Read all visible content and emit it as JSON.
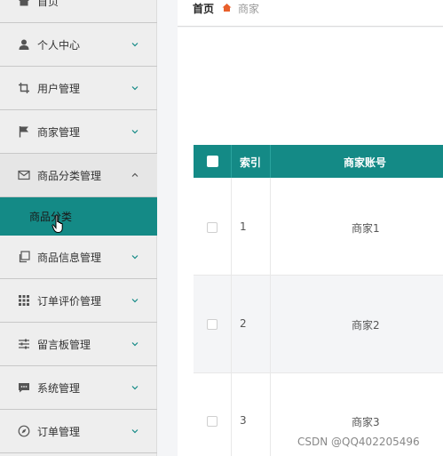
{
  "sidebar": {
    "items": [
      {
        "label": "首页",
        "icon": "home-icon"
      },
      {
        "label": "个人中心",
        "icon": "user-icon"
      },
      {
        "label": "用户管理",
        "icon": "crop-icon"
      },
      {
        "label": "商家管理",
        "icon": "flag-icon"
      },
      {
        "label": "商品分类管理",
        "icon": "mail-icon"
      },
      {
        "label": "商品信息管理",
        "icon": "copy-icon"
      },
      {
        "label": "订单评价管理",
        "icon": "grid-icon"
      },
      {
        "label": "留言板管理",
        "icon": "sliders-icon"
      },
      {
        "label": "系统管理",
        "icon": "chat-icon"
      },
      {
        "label": "订单管理",
        "icon": "compass-icon"
      }
    ],
    "submenu_label": "商品分类"
  },
  "breadcrumb": {
    "home": "首页",
    "current": "商家"
  },
  "table": {
    "headers": [
      "索引",
      "商家账号"
    ],
    "rows": [
      {
        "index": "1",
        "account": "商家1"
      },
      {
        "index": "2",
        "account": "商家2"
      },
      {
        "index": "3",
        "account": "商家3"
      }
    ]
  },
  "watermark": "CSDN @QQ402205496",
  "colors": {
    "accent": "#148a86",
    "sidebar_bg": "#eeeeee"
  }
}
